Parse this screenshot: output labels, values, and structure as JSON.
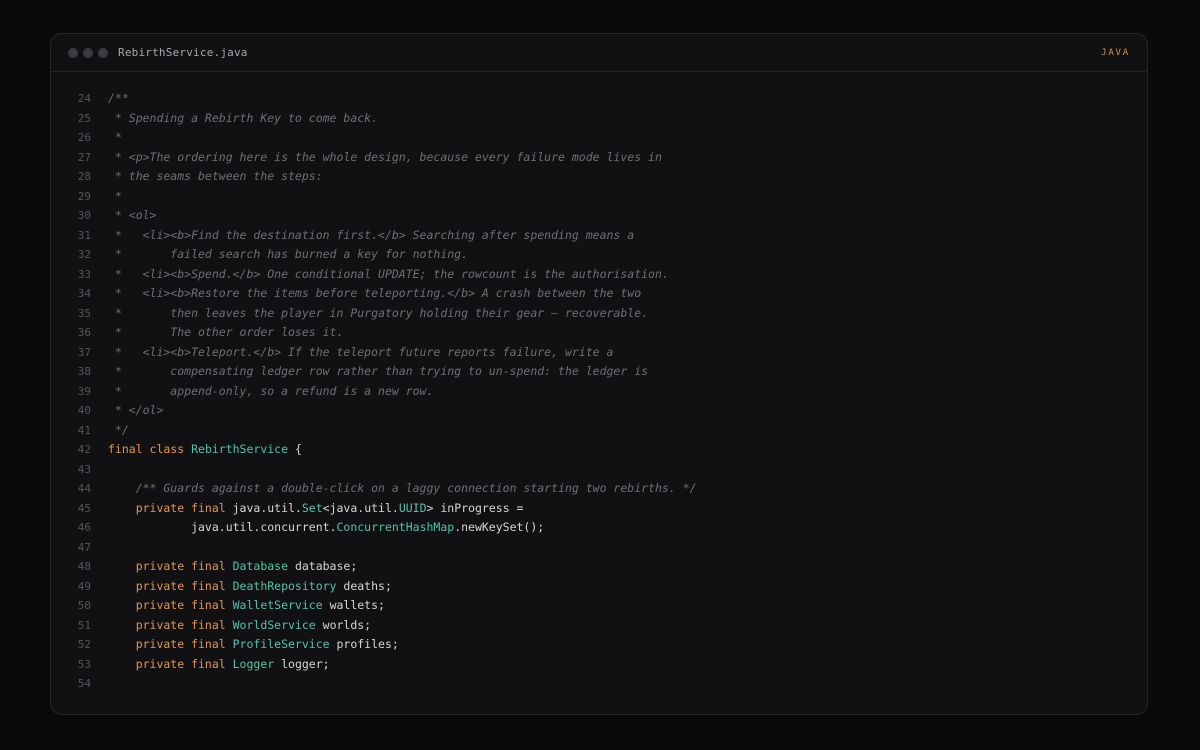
{
  "window": {
    "filename": "RebirthService.java",
    "language": "JAVA"
  },
  "code": {
    "lines": [
      {
        "n": "24",
        "tokens": [
          {
            "c": "c",
            "t": "/**"
          }
        ]
      },
      {
        "n": "25",
        "tokens": [
          {
            "c": "c",
            "t": " * Spending a Rebirth Key to come back."
          }
        ]
      },
      {
        "n": "26",
        "tokens": [
          {
            "c": "c",
            "t": " *"
          }
        ]
      },
      {
        "n": "27",
        "tokens": [
          {
            "c": "c",
            "t": " * <p>The ordering here is the whole design, because every failure mode lives in"
          }
        ]
      },
      {
        "n": "28",
        "tokens": [
          {
            "c": "c",
            "t": " * the seams between the steps:"
          }
        ]
      },
      {
        "n": "29",
        "tokens": [
          {
            "c": "c",
            "t": " *"
          }
        ]
      },
      {
        "n": "30",
        "tokens": [
          {
            "c": "c",
            "t": " * <ol>"
          }
        ]
      },
      {
        "n": "31",
        "tokens": [
          {
            "c": "c",
            "t": " *   <li><b>Find the destination first.</b> Searching after spending means a"
          }
        ]
      },
      {
        "n": "32",
        "tokens": [
          {
            "c": "c",
            "t": " *       failed search has burned a key for nothing."
          }
        ]
      },
      {
        "n": "33",
        "tokens": [
          {
            "c": "c",
            "t": " *   <li><b>Spend.</b> One conditional UPDATE; the rowcount is the authorisation."
          }
        ]
      },
      {
        "n": "34",
        "tokens": [
          {
            "c": "c",
            "t": " *   <li><b>Restore the items before teleporting.</b> A crash between the two"
          }
        ]
      },
      {
        "n": "35",
        "tokens": [
          {
            "c": "c",
            "t": " *       then leaves the player in Purgatory holding their gear — recoverable."
          }
        ]
      },
      {
        "n": "36",
        "tokens": [
          {
            "c": "c",
            "t": " *       The other order loses it."
          }
        ]
      },
      {
        "n": "37",
        "tokens": [
          {
            "c": "c",
            "t": " *   <li><b>Teleport.</b> If the teleport future reports failure, write a"
          }
        ]
      },
      {
        "n": "38",
        "tokens": [
          {
            "c": "c",
            "t": " *       compensating ledger row rather than trying to un-spend: the ledger is"
          }
        ]
      },
      {
        "n": "39",
        "tokens": [
          {
            "c": "c",
            "t": " *       append-only, so a refund is a new row."
          }
        ]
      },
      {
        "n": "40",
        "tokens": [
          {
            "c": "c",
            "t": " * </ol>"
          }
        ]
      },
      {
        "n": "41",
        "tokens": [
          {
            "c": "c",
            "t": " */"
          }
        ]
      },
      {
        "n": "42",
        "tokens": [
          {
            "c": "k",
            "t": "final class "
          },
          {
            "c": "t",
            "t": "RebirthService"
          },
          {
            "c": "p",
            "t": " {"
          }
        ]
      },
      {
        "n": "43",
        "tokens": []
      },
      {
        "n": "44",
        "tokens": [
          {
            "c": "c",
            "t": "    /** Guards against a double-click on a laggy connection starting two rebirths. */"
          }
        ]
      },
      {
        "n": "45",
        "tokens": [
          {
            "c": "k",
            "t": "    private final "
          },
          {
            "c": "p",
            "t": "java.util."
          },
          {
            "c": "t",
            "t": "Set"
          },
          {
            "c": "p",
            "t": "<java.util."
          },
          {
            "c": "t",
            "t": "UUID"
          },
          {
            "c": "p",
            "t": "> inProgress ="
          }
        ]
      },
      {
        "n": "46",
        "tokens": [
          {
            "c": "p",
            "t": "            java.util.concurrent."
          },
          {
            "c": "t",
            "t": "ConcurrentHashMap"
          },
          {
            "c": "p",
            "t": ".newKeySet();"
          }
        ]
      },
      {
        "n": "47",
        "tokens": []
      },
      {
        "n": "48",
        "tokens": [
          {
            "c": "k",
            "t": "    private final "
          },
          {
            "c": "t",
            "t": "Database"
          },
          {
            "c": "p",
            "t": " database;"
          }
        ]
      },
      {
        "n": "49",
        "tokens": [
          {
            "c": "k",
            "t": "    private final "
          },
          {
            "c": "t",
            "t": "DeathRepository"
          },
          {
            "c": "p",
            "t": " deaths;"
          }
        ]
      },
      {
        "n": "50",
        "tokens": [
          {
            "c": "k",
            "t": "    private final "
          },
          {
            "c": "t",
            "t": "WalletService"
          },
          {
            "c": "p",
            "t": " wallets;"
          }
        ]
      },
      {
        "n": "51",
        "tokens": [
          {
            "c": "k",
            "t": "    private final "
          },
          {
            "c": "t",
            "t": "WorldService"
          },
          {
            "c": "p",
            "t": " worlds;"
          }
        ]
      },
      {
        "n": "52",
        "tokens": [
          {
            "c": "k",
            "t": "    private final "
          },
          {
            "c": "t",
            "t": "ProfileService"
          },
          {
            "c": "p",
            "t": " profiles;"
          }
        ]
      },
      {
        "n": "53",
        "tokens": [
          {
            "c": "k",
            "t": "    private final "
          },
          {
            "c": "t",
            "t": "Logger"
          },
          {
            "c": "p",
            "t": " logger;"
          }
        ]
      },
      {
        "n": "54",
        "tokens": []
      }
    ]
  }
}
